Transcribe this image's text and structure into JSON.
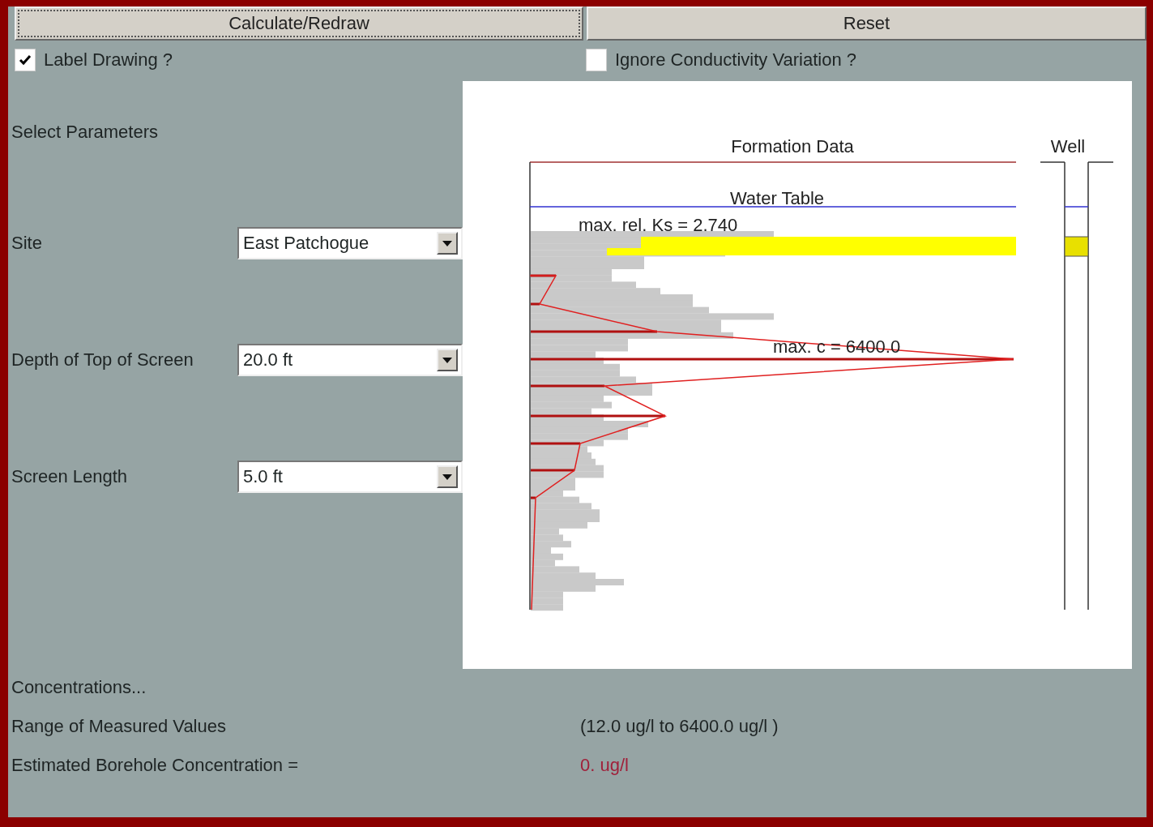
{
  "buttons": [
    {
      "label": "Calculate/Redraw",
      "focused": true
    },
    {
      "label": "Reset",
      "focused": false
    }
  ],
  "checkboxes": [
    {
      "label": "Label Drawing ?",
      "checked": true
    },
    {
      "label": "Ignore Conductivity Variation ?",
      "checked": false
    }
  ],
  "parameters": {
    "heading": "Select Parameters",
    "fields": [
      {
        "label": "Site",
        "value": "East Patchogue"
      },
      {
        "label": "Depth of Top of Screen",
        "value": "20.0 ft"
      },
      {
        "label": "Screen Length",
        "value": "5.0 ft"
      }
    ]
  },
  "drawing": {
    "title": "Formation Data",
    "well_title": "Well",
    "water_table": "Water Table",
    "ks_label": "max. rel. Ks = 2.740",
    "c_label": "max. c = 6400.0"
  },
  "concentrations": {
    "heading": "Concentrations...",
    "rows": [
      {
        "label": "Range of Measured Values",
        "value": "(12.0 ug/l to 6400.0 ug/l )",
        "kind": "plain"
      },
      {
        "label": "Estimated Borehole Concentration =",
        "value": "0. ug/l",
        "kind": "result"
      }
    ]
  }
}
